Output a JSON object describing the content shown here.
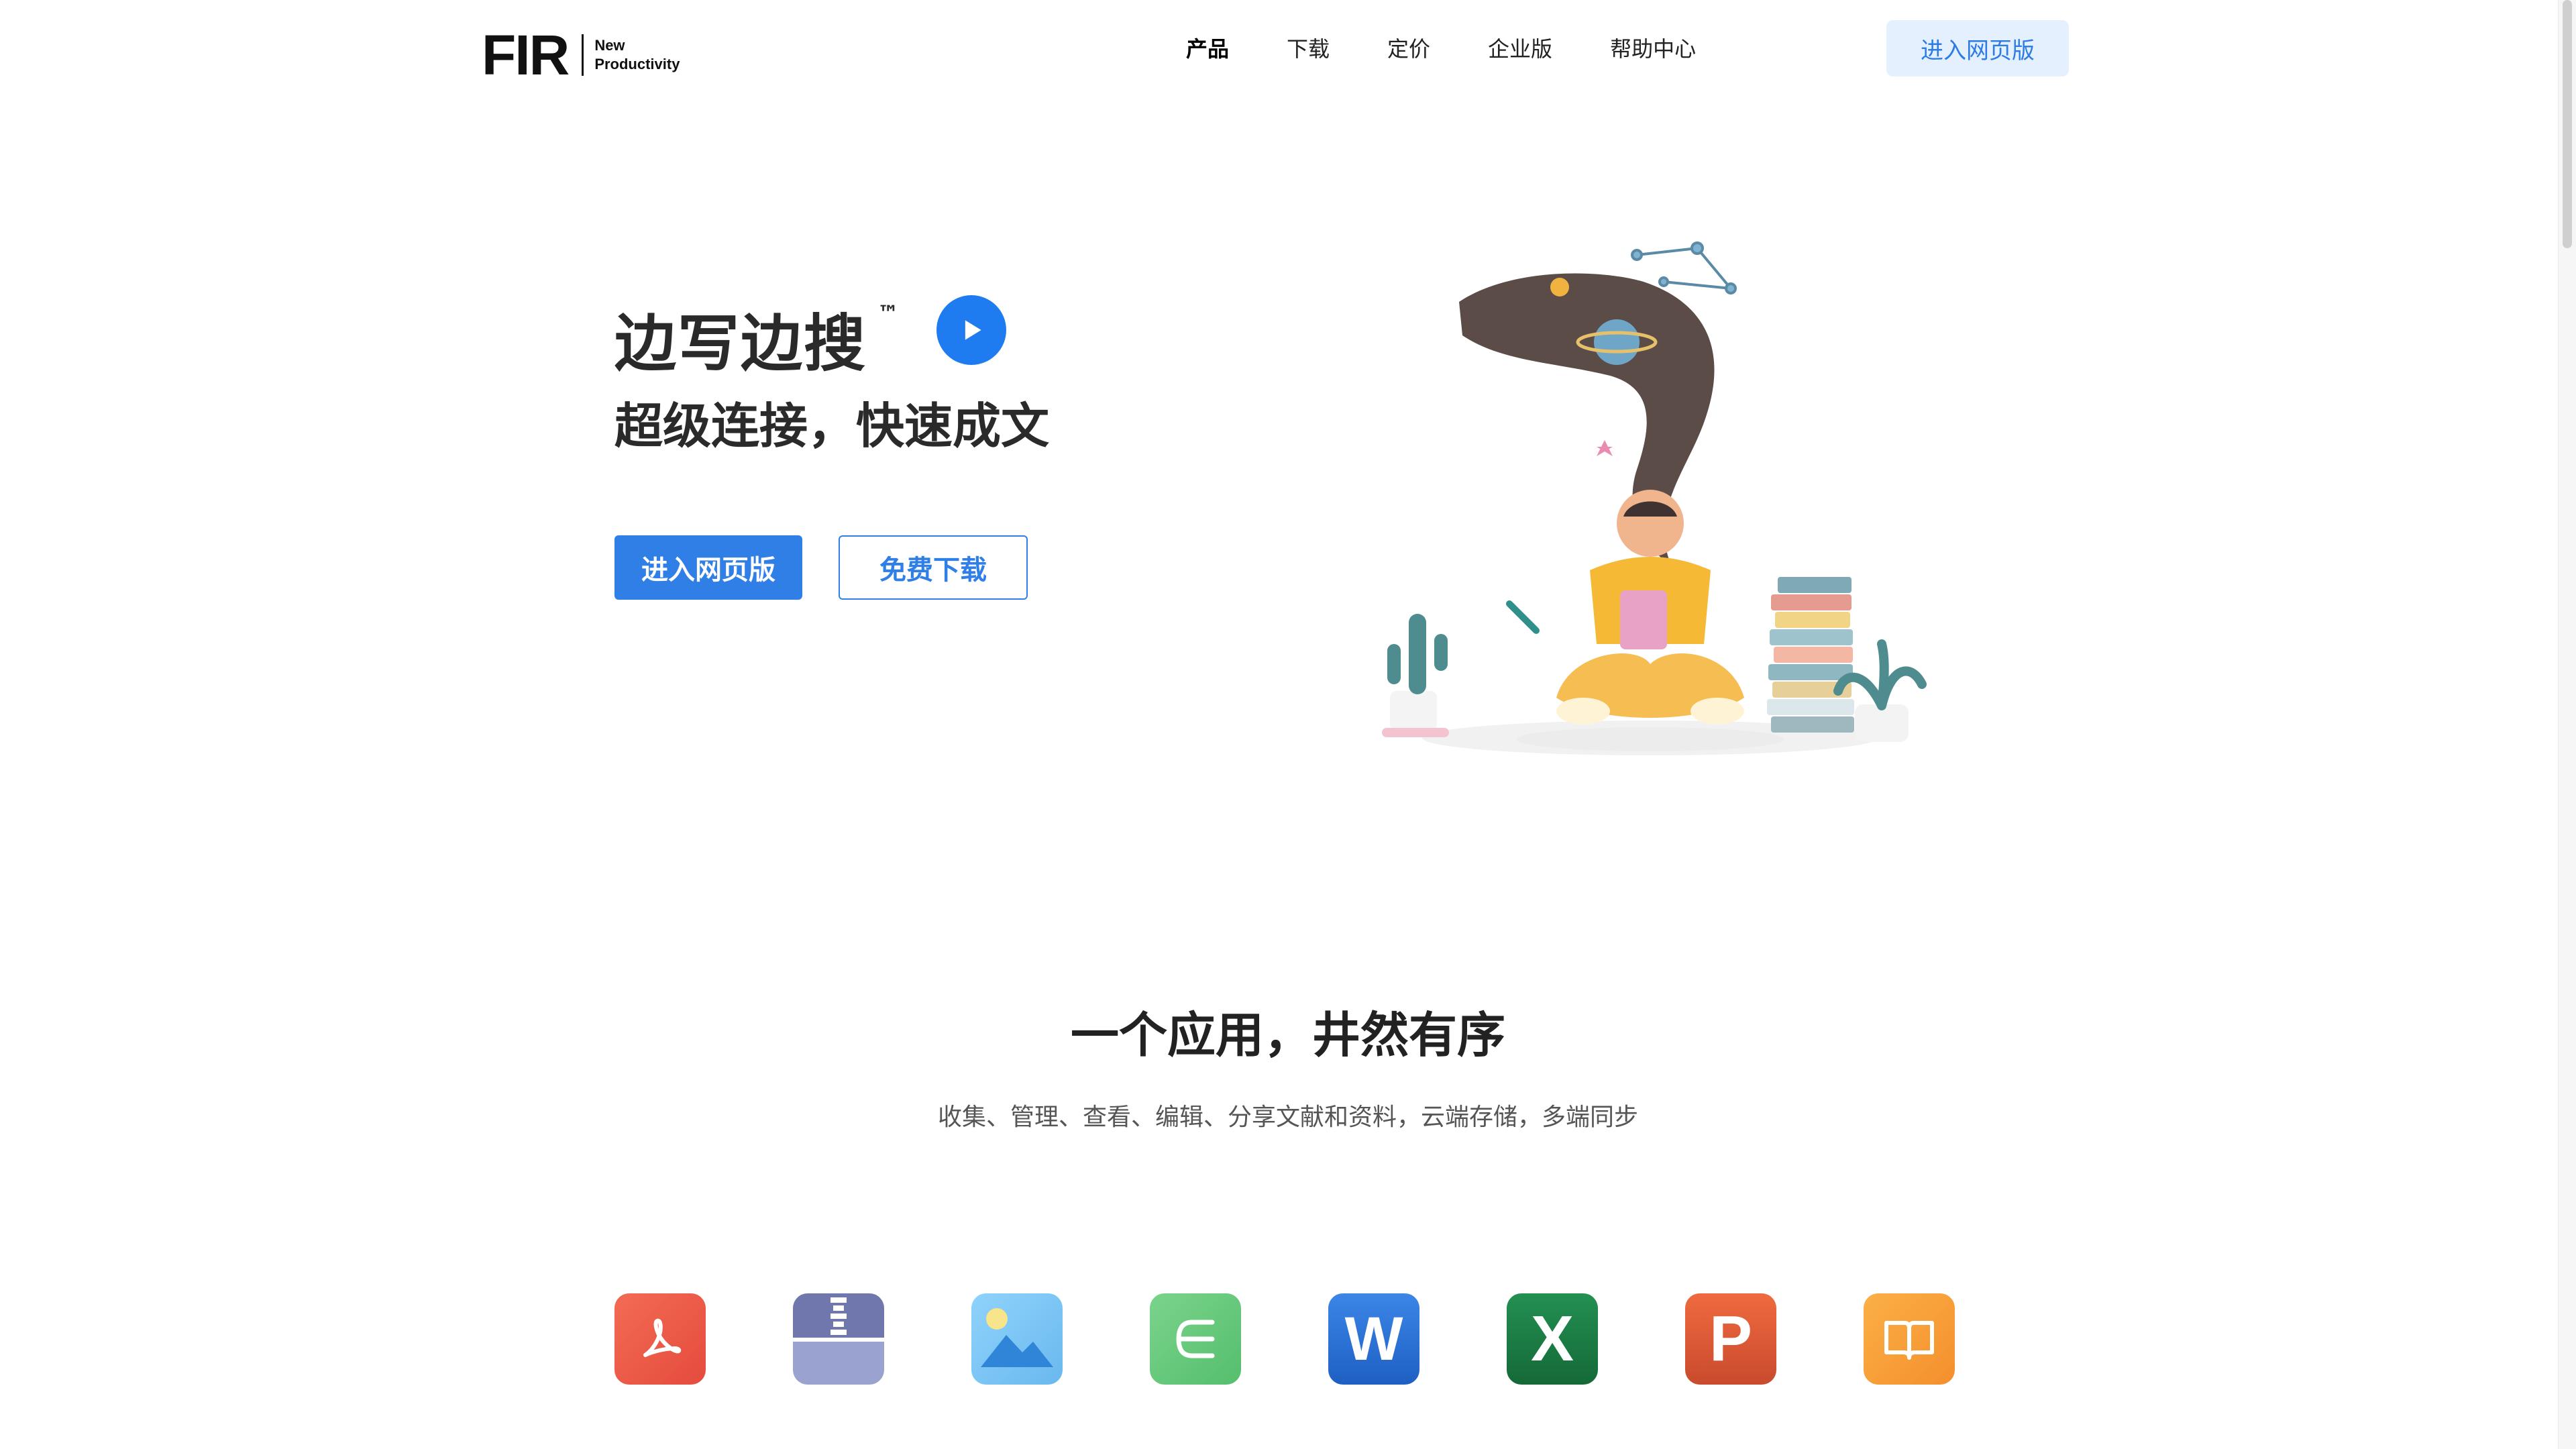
{
  "header": {
    "logo": "FIR",
    "logo_tagline_1": "New",
    "logo_tagline_2": "Productivity",
    "nav": [
      "产品",
      "下载",
      "定价",
      "企业版",
      "帮助中心"
    ],
    "cta": "进入网页版"
  },
  "hero": {
    "title": "边写边搜",
    "tm": "™",
    "subtitle": "超级连接，快速成文",
    "btn_primary": "进入网页版",
    "btn_secondary": "免费下载"
  },
  "section": {
    "title": "一个应用，井然有序",
    "subtitle": "收集、管理、查看、编辑、分享文献和资料，云端存储，多端同步"
  },
  "icons": [
    {
      "name": "pdf-icon",
      "color": "#ee5a48"
    },
    {
      "name": "zip-icon",
      "color": "#7b83b8"
    },
    {
      "name": "image-icon",
      "color": "#7cc7f5"
    },
    {
      "name": "mindmap-icon",
      "color": "#63c97a"
    },
    {
      "name": "word-icon",
      "color": "#2b6fd6",
      "letter": "W"
    },
    {
      "name": "excel-icon",
      "color": "#1d7a43",
      "letter": "X"
    },
    {
      "name": "powerpoint-icon",
      "color": "#dd5a35",
      "letter": "P"
    },
    {
      "name": "book-icon",
      "color": "#f7a23a"
    }
  ],
  "colors": {
    "accent": "#2f7fe6",
    "play": "#1e7cf0"
  }
}
